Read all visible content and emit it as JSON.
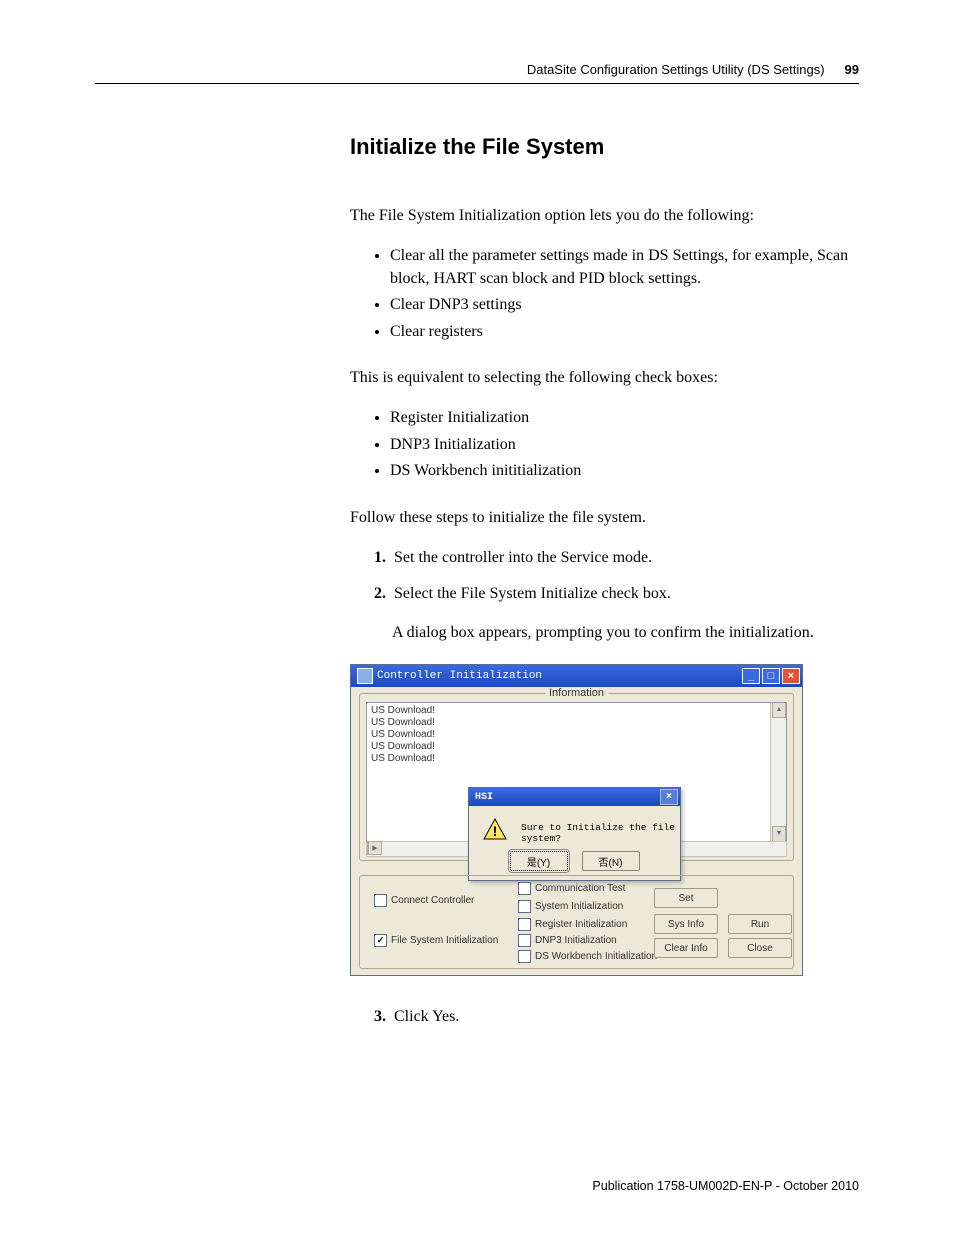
{
  "header": {
    "section": "DataSite Configuration Settings Utility (DS Settings)",
    "page": "99"
  },
  "h2": "Initialize the File System",
  "p1": "The File System Initialization option lets you do the following:",
  "ul1": [
    "Clear all the parameter settings made in DS Settings, for example, Scan block, HART scan block and PID block settings.",
    "Clear DNP3 settings",
    "Clear registers"
  ],
  "p2": "This is equivalent to selecting the following check boxes:",
  "ul2": [
    "Register Initialization",
    "DNP3 Initialization",
    "DS Workbench inititialization"
  ],
  "p3": "Follow these steps to initialize the file system.",
  "ol": [
    "Set the controller into the Service mode.",
    "Select the File System Initialize check box."
  ],
  "sub": "A dialog box appears, prompting you to confirm the initialization.",
  "ol3": "Click Yes.",
  "shot": {
    "title": "Controller Initialization",
    "infoLegend": "Information",
    "lines": [
      "US Download!",
      "US Download!",
      "US Download!",
      "US Download!",
      "US Download!"
    ],
    "popup": {
      "title": "HSI",
      "msg": "Sure to Initialize the file system?",
      "yes": "是(Y)",
      "no": "否(N)"
    },
    "cb": {
      "connect": "Connect Controller",
      "fsi": "File System Initialization",
      "comm": "Communication Test",
      "sys": "System Initialization",
      "reg": "Register Initialization",
      "dnp": "DNP3 Initialization",
      "dsw": "DS Workbench Initialization"
    },
    "btn": {
      "set": "Set",
      "sys": "Sys Info",
      "clear": "Clear Info",
      "run": "Run",
      "close": "Close"
    }
  },
  "footer": "Publication 1758-UM002D-EN-P - October 2010"
}
